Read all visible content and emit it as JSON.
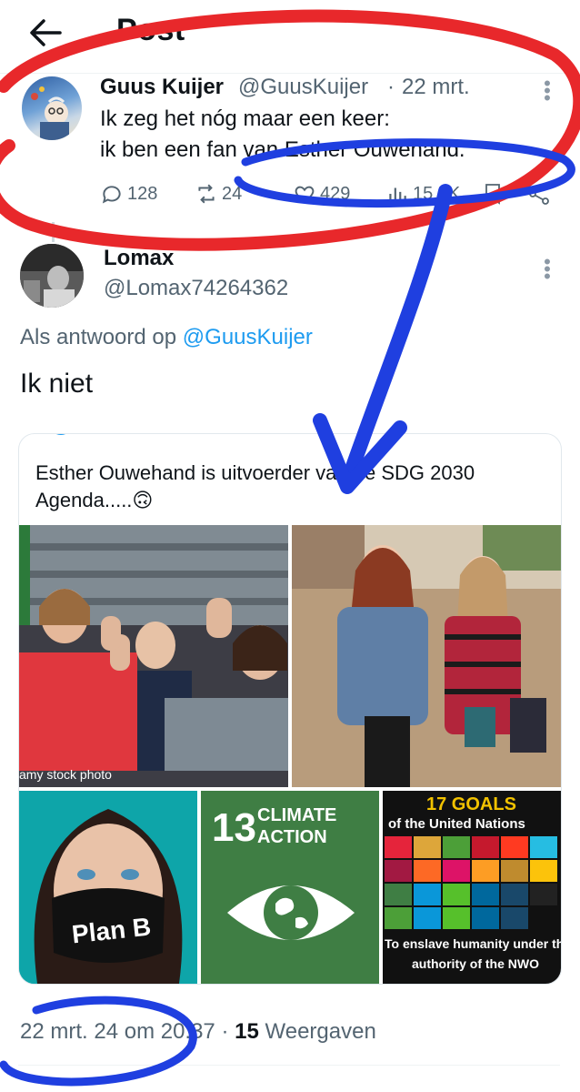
{
  "header": {
    "title": "Post",
    "back_icon": "arrow-left-icon"
  },
  "original_tweet": {
    "name": "Guus Kuijer",
    "handle": "@GuusKuijer",
    "separator": "·",
    "date": "22 mrt.",
    "text_line1": "Ik zeg het nóg maar een keer:",
    "text_line2": "ik ben een fan van Esther Ouwehand.",
    "replies": "128",
    "reposts": "24",
    "likes": "429",
    "views": "15,5K"
  },
  "reply": {
    "name": "Lomax",
    "handle": "@Lomax74264362",
    "reply_prefix": "Als antwoord op",
    "reply_to": "@GuusKuijer",
    "text": "Ik niet",
    "quote": {
      "text_line1": "Esther Ouwehand is uitvoerder van de SDG 2030",
      "text_line2": "Agenda.....🙃"
    },
    "images": {
      "img1_caption": "amy stock photo",
      "img3_mask_text": "Plan B",
      "img4_number": "13",
      "img4_line1": "CLIMATE",
      "img4_line2": "ACTION",
      "img5_title": "17 GOALS",
      "img5_subtitle": "of the United Nations",
      "img5_caption_line1": "To enslave humanity under the",
      "img5_caption_line2": "authority of the NWO"
    },
    "footer": {
      "datetime": "22 mrt. 24 om 20:37",
      "separator": "·",
      "views_count": "15",
      "views_label": "Weergaven"
    }
  },
  "annotations": {
    "red_ellipse_color": "#e8282b",
    "blue_marker_color": "#1f3fe0"
  }
}
